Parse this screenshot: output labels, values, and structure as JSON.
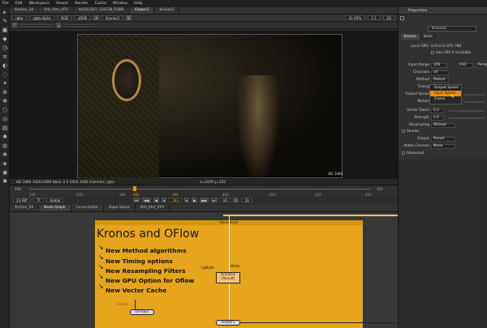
{
  "menu": [
    "File",
    "Edit",
    "Workspace",
    "Viewer",
    "Render",
    "Cache",
    "Window",
    "Help"
  ],
  "viewer_tabs": [
    {
      "label": "Anchor_30",
      "active": false
    },
    {
      "label": "Shh_film_VFX",
      "active": false
    },
    {
      "label": "A015C007_120728_R3BR",
      "active": false
    },
    {
      "label": "Viewer1",
      "active": true
    }
  ],
  "viewer_tab_extra": "Kronos3",
  "viewer_toolbar": {
    "channels": "rgba",
    "alpha": "rgba.alpha",
    "space": "RGB",
    "lut": "sRGB",
    "a_input": "A",
    "a_node": "Kronos3",
    "b_input": "B",
    "zoom": "41.45%",
    "ratio": "1:1",
    "view": "2D"
  },
  "viewer_info": {
    "format_label": "HD 1080",
    "status_left": "HD 1080 1920x1080  bbox: 0 0 1920 1080 channels: rgba",
    "status_mid": "x=2429 y=103"
  },
  "timeline": {
    "start": "359",
    "end": "433",
    "ticks": [
      "359",
      "370",
      "380",
      "382",
      "390",
      "400",
      "410",
      "420",
      "433"
    ],
    "current_frame": "382",
    "fps_label": "23.98*",
    "tf_label": "TF",
    "range_mode": "Global",
    "step": "10",
    "step2": "10"
  },
  "node_tabs": [
    {
      "label": "Anchor_30",
      "active": false
    },
    {
      "label": "Node Graph",
      "active": true
    },
    {
      "label": "Curve Editor",
      "active": false
    },
    {
      "label": "Dope Sheet",
      "active": false
    },
    {
      "label": "Shh_film_VFX",
      "active": false
    }
  ],
  "properties": {
    "title": "Properties",
    "node_name": "Kronos3",
    "tabs": [
      "Kronos",
      "Node"
    ],
    "local_gpu_label": "Local GPU:",
    "local_gpu_value": "GeForce GTX 780",
    "use_gpu": "Use GPU if available",
    "input_range_label": "Input Range",
    "input_range_from": "359",
    "input_range_to": "433",
    "reset_label": "Reset",
    "channels_label": "Channels",
    "channels_value": "all",
    "method_label": "Method",
    "method_value": "Motion",
    "timing_label": "Timing",
    "timing_value": "Output Speed",
    "output_speed_label": "Output Speed",
    "motion_label": "Motion",
    "vector_detail_label": "Vector Detail",
    "vector_detail_value": "0.3",
    "strength_label": "Strength",
    "strength_value": "1.5",
    "resampling_label": "Resampling",
    "resampling_value": "Bilinear",
    "shutter_label": "Shutter",
    "output_label": "Output",
    "output_value": "Result",
    "matte_label": "Matte Channel",
    "matte_value": "None",
    "advanced_label": "Advanced"
  },
  "timing_dropdown": [
    "Output Speed",
    "Input Speed",
    "Frame"
  ],
  "node_graph": {
    "backdrop_label": "Backdrop4",
    "title": "Kronos and OFlow",
    "features": [
      "New Method algorithms",
      "New Timing options",
      "New Resampling Filters",
      "New GPU Option for Oflow",
      "New Vector Cache"
    ],
    "node_kronos": "Kronos3",
    "node_kronos_sub": "(Result)",
    "node_oflow": "OFlow3",
    "node_viewer": "Viewer1",
    "label_fgmatte": "FgMatte",
    "label_matte": "Matte",
    "label_source": "Source"
  },
  "colors": {
    "accent": "#f08c00",
    "backdrop": "#e6a51c",
    "kronos_node": "#f2c27a"
  }
}
